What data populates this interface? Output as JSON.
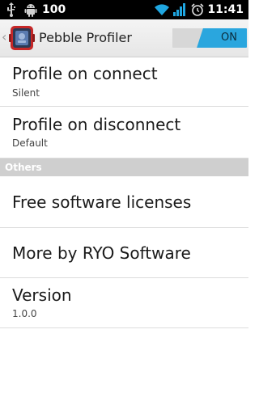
{
  "status_bar": {
    "battery_level": "100",
    "clock": "11:41",
    "icons": [
      "usb-icon",
      "android-debug-icon",
      "wifi-icon",
      "signal-icon",
      "alarm-icon"
    ]
  },
  "action_bar": {
    "title": "Pebble Profiler",
    "toggle_label": "ON",
    "toggle_state": "on",
    "accent_color": "#2aa6de"
  },
  "preferences": [
    {
      "title": "Profile on connect",
      "summary": "Silent"
    },
    {
      "title": "Profile on disconnect",
      "summary": "Default"
    }
  ],
  "section": {
    "title": "Others"
  },
  "others": [
    {
      "title": "Free software licenses"
    },
    {
      "title": "More by RYO Software"
    },
    {
      "title": "Version",
      "summary": "1.0.0"
    }
  ]
}
